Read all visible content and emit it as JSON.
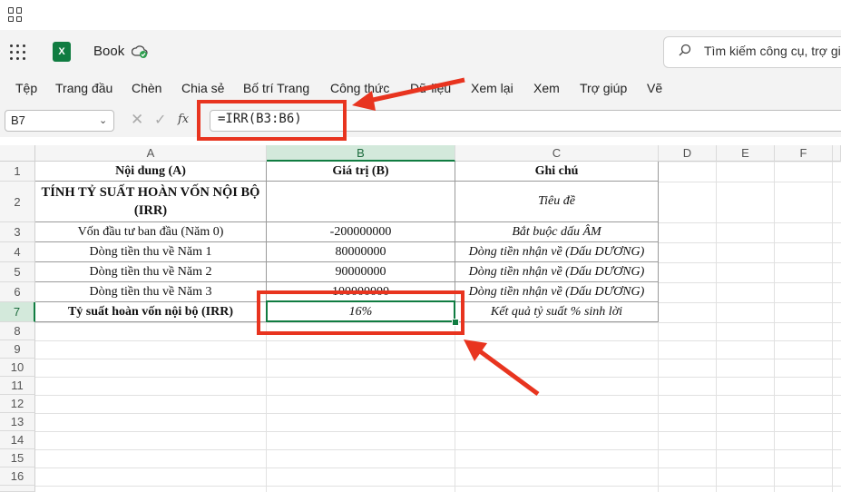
{
  "app": {
    "title": "Book",
    "search_placeholder": "Tìm kiếm công cụ, trợ giú"
  },
  "ribbon": {
    "tabs": [
      "Tệp",
      "Trang đầu",
      "Chèn",
      "Chia sẻ",
      "Bố trí Trang",
      "Công thức",
      "Dữ liệu",
      "Xem lại",
      "Xem",
      "Trợ giúp",
      "Vẽ"
    ]
  },
  "formula_bar": {
    "name_box": "B7",
    "formula": "=IRR(B3:B6)",
    "fx_label": "fx"
  },
  "sheet": {
    "columns": [
      "A",
      "B",
      "C",
      "D",
      "E",
      "F"
    ],
    "rows": [
      "1",
      "2",
      "3",
      "4",
      "5",
      "6",
      "7",
      "8",
      "9",
      "10",
      "11",
      "12",
      "13",
      "14",
      "15",
      "16"
    ],
    "selected_cell": "B7",
    "cells": {
      "A1": "Nội dung (A)",
      "B1": "Giá trị (B)",
      "C1": "Ghi chú",
      "A2": "TÍNH TỶ SUẤT HOÀN VỐN NỘI BỘ (IRR)",
      "C2": "Tiêu đề",
      "A3": "Vốn đầu tư ban đầu (Năm 0)",
      "B3": "-200000000",
      "C3": "Bắt buộc dấu ÂM",
      "A4": "Dòng tiền thu về Năm 1",
      "B4": "80000000",
      "C4": "Dòng tiền nhận về (Dấu DƯƠNG)",
      "A5": "Dòng tiền thu về Năm 2",
      "B5": "90000000",
      "C5": "Dòng tiền nhận về (Dấu DƯƠNG)",
      "A6": "Dòng tiền thu về Năm 3",
      "B6": "100000000",
      "C6": "Dòng tiền nhận về (Dấu DƯƠNG)",
      "A7": "Tỷ suất hoàn vốn nội bộ (IRR)",
      "B7": "16%",
      "C7": "Kết quả tỷ suất % sinh lời"
    }
  },
  "colors": {
    "accent": "#107c41",
    "annotation": "#e8341f",
    "header_bg": "#f3f3f3"
  }
}
